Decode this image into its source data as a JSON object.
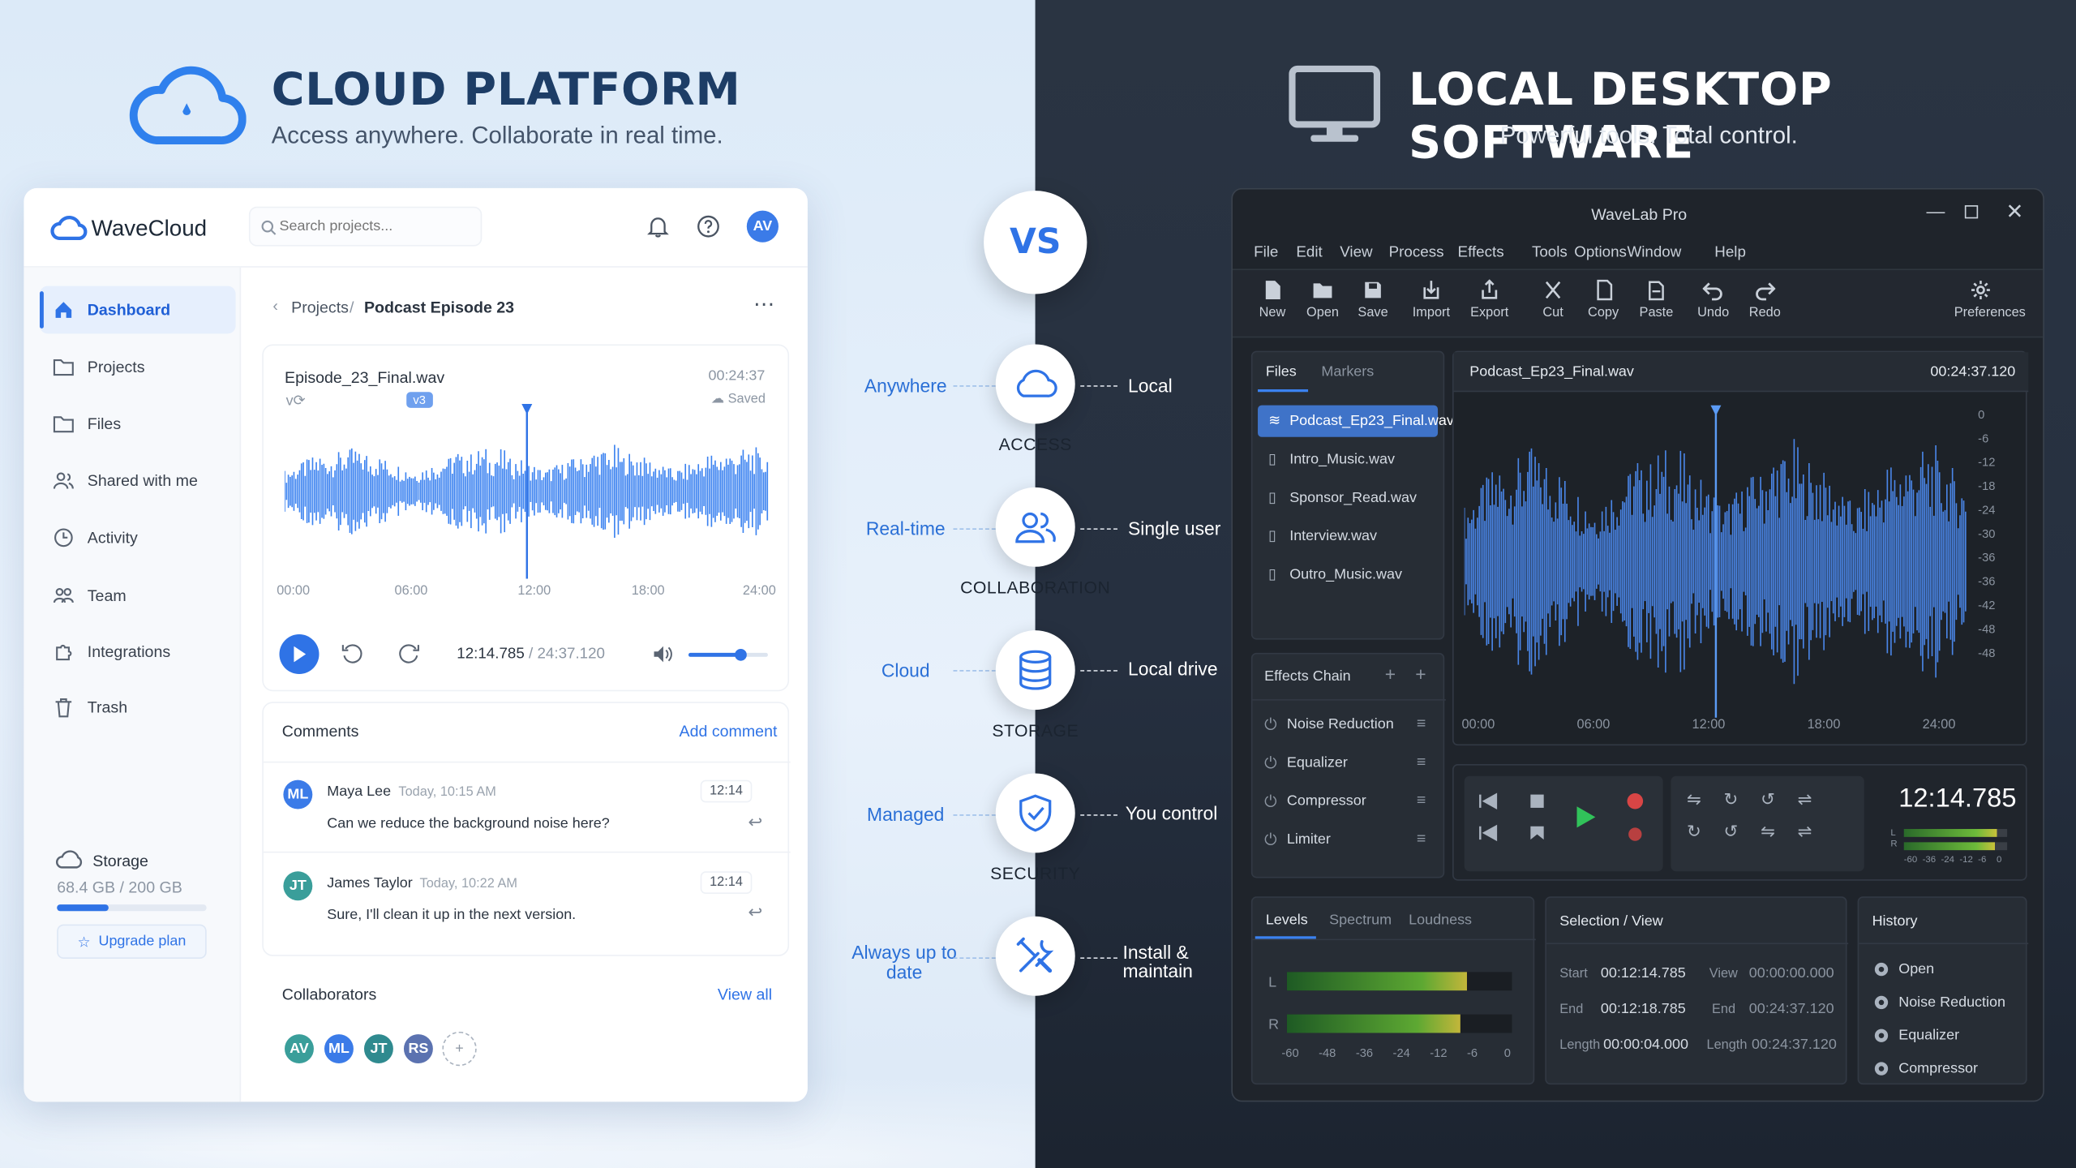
{
  "colors": {
    "accent": "#2f73e6",
    "dark_bg": "#262f3c",
    "wave_blue": "#3b82f0"
  },
  "cloud": {
    "title": "CLOUD PLATFORM",
    "subtitle": "Access anywhere. Collaborate in real time.",
    "app_name": "WaveCloud",
    "search_placeholder": "Search projects...",
    "user_initials": "AV",
    "nav": [
      {
        "label": "Dashboard",
        "icon": "home-icon"
      },
      {
        "label": "Projects",
        "icon": "folder-icon"
      },
      {
        "label": "Files",
        "icon": "folder-icon"
      },
      {
        "label": "Shared with me",
        "icon": "users-icon"
      },
      {
        "label": "Activity",
        "icon": "clock-icon"
      },
      {
        "label": "Team",
        "icon": "team-icon"
      },
      {
        "label": "Integrations",
        "icon": "puzzle-icon"
      },
      {
        "label": "Trash",
        "icon": "trash-icon"
      }
    ],
    "storage": {
      "label": "Storage",
      "usage": "68.4 GB / 200 GB",
      "fraction": 0.342,
      "upgrade": "Upgrade plan"
    },
    "breadcrumb": {
      "parent": "Projects",
      "sep": "/",
      "current": "Podcast Episode 23"
    },
    "player": {
      "file": "Episode_23_Final.wav",
      "duration": "00:24:37",
      "version_prefix": "v",
      "version": "v3",
      "saved": "Saved",
      "ticks": [
        "00:00",
        "06:00",
        "12:00",
        "18:00",
        "24:00"
      ],
      "time_current": "12:14.785",
      "time_sep": " / ",
      "time_total": "24:37.120",
      "playhead": 0.5,
      "volume": 0.65
    },
    "comments": {
      "title": "Comments",
      "add": "Add comment",
      "items": [
        {
          "initials": "ML",
          "name": "Maya Lee",
          "time": "Today, 10:15 AM",
          "stamp": "12:14",
          "text": "Can we reduce the background noise here?",
          "color": "#3b7be8"
        },
        {
          "initials": "JT",
          "name": "James Taylor",
          "time": "Today, 10:22 AM",
          "stamp": "12:14",
          "text": "Sure, I'll clean it up in the next version.",
          "color": "#3a9e9a"
        }
      ]
    },
    "collab": {
      "title": "Collaborators",
      "view_all": "View all",
      "avatars": [
        {
          "i": "AV",
          "c": "#3a9e9a"
        },
        {
          "i": "ML",
          "c": "#3b7be8"
        },
        {
          "i": "JT",
          "c": "#2f8a8f"
        },
        {
          "i": "RS",
          "c": "#5b72b0"
        }
      ],
      "add": "+"
    }
  },
  "vs": {
    "label": "VS",
    "features": [
      {
        "left": "Anywhere",
        "name": "ACCESS",
        "right": "Local",
        "icon": "cloud-icon"
      },
      {
        "left": "Real-time",
        "name": "COLLABORATION",
        "right": "Single user",
        "icon": "users-icon"
      },
      {
        "left": "Cloud",
        "name": "STORAGE",
        "right": "Local drive",
        "icon": "database-icon"
      },
      {
        "left": "Managed",
        "name": "SECURITY",
        "right": "You control",
        "icon": "shield-icon"
      },
      {
        "left": "Always up to date",
        "name": "",
        "right": "Install & maintain",
        "icon": "tools-icon"
      }
    ]
  },
  "desktop": {
    "title": "LOCAL DESKTOP SOFTWARE",
    "subtitle": "Powerful tools. Total control.",
    "app": "WaveLab Pro",
    "menu": [
      "File",
      "Edit",
      "View",
      "Process",
      "Effects",
      "Tools",
      "Options",
      "Window",
      "Help"
    ],
    "toolbar": [
      "New",
      "Open",
      "Save",
      "Import",
      "Export",
      "Cut",
      "Copy",
      "Paste",
      "Undo",
      "Redo"
    ],
    "preferences": "Preferences",
    "tabs": [
      "Files",
      "Markers"
    ],
    "files": [
      "Podcast_Ep23_Final.wav",
      "Intro_Music.wav",
      "Sponsor_Read.wav",
      "Interview.wav",
      "Outro_Music.wav"
    ],
    "effects_title": "Effects Chain",
    "effects": [
      "Noise Reduction",
      "Equalizer",
      "Compressor",
      "Limiter"
    ],
    "wave_file": "Podcast_Ep23_Final.wav",
    "wave_time": "00:24:37.120",
    "db_ticks": [
      "0",
      "-6",
      "-12",
      "-18",
      "-24",
      "-30",
      "-36",
      "-36",
      "-42",
      "-48",
      "-48"
    ],
    "ticks": [
      "00:00",
      "06:00",
      "12:00",
      "18:00",
      "24:00"
    ],
    "time": "12:14.785",
    "meter_ticks": [
      "-60",
      "-36",
      "-24",
      "-12",
      "-6",
      "0"
    ],
    "levels_tabs": [
      "Levels",
      "Spectrum",
      "Loudness"
    ],
    "channels": [
      "L",
      "R"
    ],
    "level_scale": [
      "-60",
      "-48",
      "-36",
      "-24",
      "-12",
      "-6",
      "0"
    ],
    "levels": [
      0.8,
      0.77
    ],
    "selection": {
      "title": "Selection / View",
      "start_l": "Start",
      "start": "00:12:14.785",
      "view_l": "View",
      "view": "00:00:00.000",
      "end_l": "End",
      "end": "00:12:18.785",
      "vend_l": "End",
      "vend": "00:24:37.120",
      "len_l": "Length",
      "len": "00:00:04.000",
      "vlen_l": "Length",
      "vlen": "00:24:37.120"
    },
    "history_title": "History",
    "history": [
      "Open",
      "Noise Reduction",
      "Equalizer",
      "Compressor"
    ]
  }
}
